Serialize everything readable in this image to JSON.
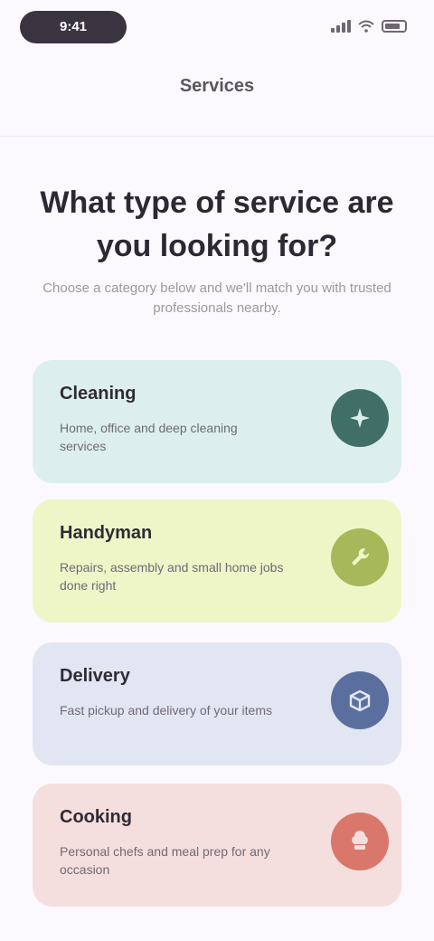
{
  "status_bar": {
    "time": "9:41"
  },
  "nav": {
    "title": "Services"
  },
  "heading": "What type of service are you looking for?",
  "subheading": "Choose a category below and we'll match you with trusted professionals nearby.",
  "cards": [
    {
      "title": "Cleaning",
      "description": "Home, office and deep cleaning services",
      "color": "#dcefec",
      "icon_color": "#3f6f66",
      "icon": "sparkle-icon"
    },
    {
      "title": "Handyman",
      "description": "Repairs, assembly and small home jobs done right",
      "color": "#eef6c8",
      "icon_color": "#a7b85a",
      "icon": "wrench-icon"
    },
    {
      "title": "Delivery",
      "description": "Fast pickup and delivery of your items",
      "color": "#e2e6f2",
      "icon_color": "#5b6f9e",
      "icon": "box-icon"
    },
    {
      "title": "Cooking",
      "description": "Personal chefs and meal prep for any occasion",
      "color": "#f5dede",
      "icon_color": "#d9776b",
      "icon": "chef-hat-icon"
    }
  ]
}
